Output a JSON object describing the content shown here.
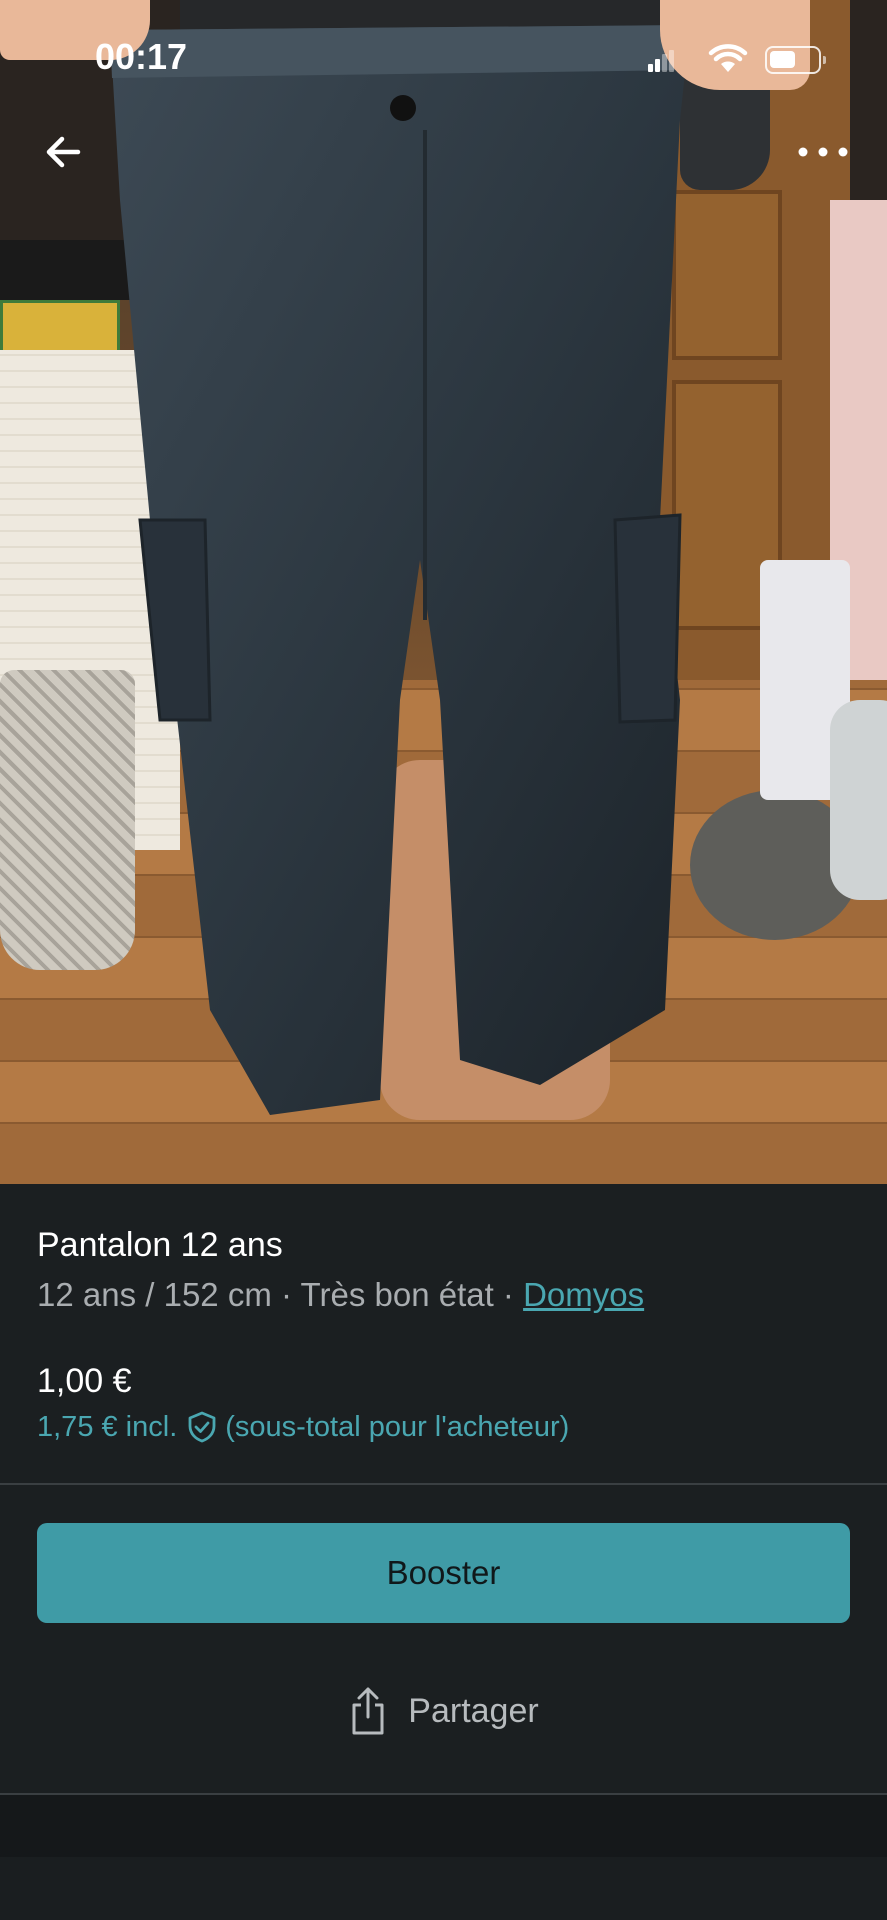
{
  "status_bar": {
    "time": "00:17"
  },
  "icons": {
    "back": "arrow-left-icon",
    "more": "more-horizontal-icon",
    "signal": "cellular-signal-icon",
    "wifi": "wifi-icon",
    "battery": "battery-icon",
    "protection": "shield-check-icon",
    "share": "share-icon"
  },
  "listing": {
    "title": "Pantalon 12 ans",
    "size": "12 ans / 152 cm",
    "separator": " · ",
    "condition": "Très bon état",
    "brand": "Domyos",
    "price": "1,00 €",
    "price_incl": "1,75 € incl.",
    "price_incl_note": "(sous-total pour l'acheteur)"
  },
  "actions": {
    "boost_label": "Booster",
    "share_label": "Partager"
  },
  "colors": {
    "accent": "#3f9ba6",
    "link": "#4aa7b1",
    "background": "#1b1f21"
  }
}
